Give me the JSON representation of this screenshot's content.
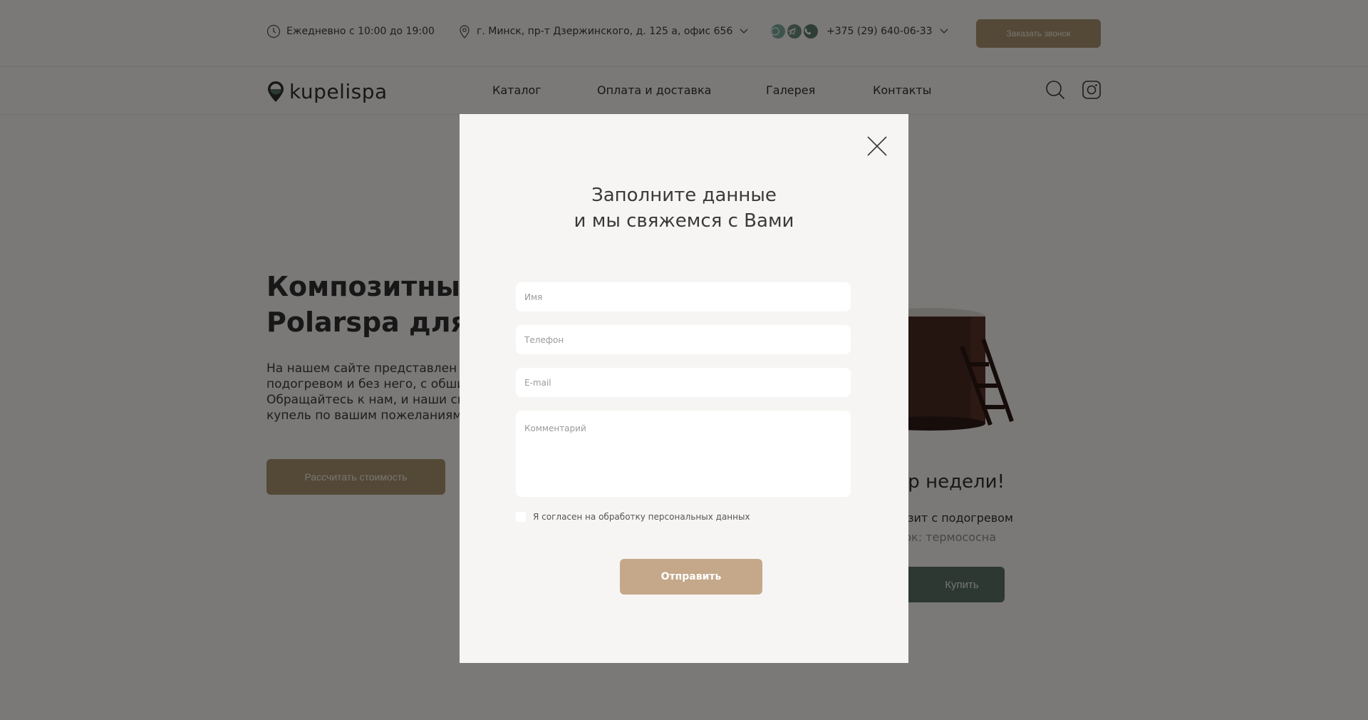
{
  "topbar": {
    "hours": "Ежедневно с 10:00 до 19:00",
    "address": "г. Минск, пр-т Дзержинского, д. 125 а, офис 656",
    "phone": "+375 (29) 640-06-33",
    "callback_label": "Заказать звонок"
  },
  "nav": {
    "logo_text": "kupelispa",
    "items": [
      "Каталог",
      "Оплата и доставка",
      "Галерея",
      "Контакты"
    ]
  },
  "hero": {
    "title": "Композитные купели Polarspa для улицы",
    "text": "На нашем сайте представлен большой выбор купелей с подогревом и без него, с обшивкой разных цветов. Обращайтесь к нам, и наши специалисты помогут подобрать купель по вашим пожеланиям! Работаем без перерывов.",
    "cta_label": "Рассчитать стоимость",
    "promo_title": "Товар недели!",
    "promo_sub1": "Купель композит с подогревом",
    "promo_sub2": "В подарок: термососна",
    "buy_label": "Купить"
  },
  "modal": {
    "title_line1": "Заполните данные",
    "title_line2": "и мы свяжемся с Вами",
    "name_placeholder": "Имя",
    "phone_placeholder": "Телефон",
    "email_placeholder": "E-mail",
    "comment_placeholder": "Комментарий",
    "consent_label": "Я согласен на обработку персональных данных",
    "submit_label": "Отправить"
  },
  "colors": {
    "accent_brown": "#a8926f",
    "submit_tan": "#c4a889",
    "buy_green": "#587063",
    "messengers": [
      "#7ba99a",
      "#6f8a7f",
      "#5e7b6f"
    ]
  }
}
